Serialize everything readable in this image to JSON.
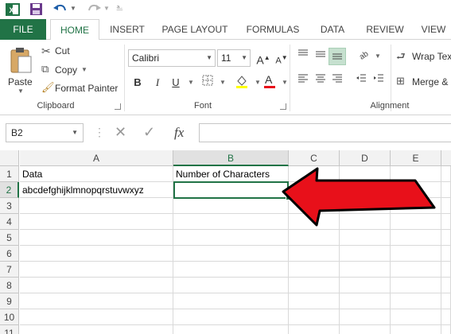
{
  "quick_access": {
    "excel_icon": "excel-icon",
    "save_icon": "save-icon",
    "undo_icon": "undo-icon",
    "redo_icon": "redo-icon",
    "customize_icon": "customize-icon"
  },
  "tabs": [
    "FILE",
    "HOME",
    "INSERT",
    "PAGE LAYOUT",
    "FORMULAS",
    "DATA",
    "REVIEW",
    "VIEW"
  ],
  "clipboard": {
    "paste": "Paste",
    "cut": "Cut",
    "copy": "Copy",
    "format_painter": "Format Painter",
    "group_label": "Clipboard"
  },
  "font": {
    "name": "Calibri",
    "size": "11",
    "bold": "B",
    "italic": "I",
    "underline": "U",
    "group_label": "Font"
  },
  "alignment": {
    "wrap_text": "Wrap Tex",
    "merge": "Merge &",
    "group_label": "Alignment"
  },
  "formula_bar": {
    "name_box": "B2",
    "fx": "fx",
    "value": ""
  },
  "columns": [
    "A",
    "B",
    "C",
    "D",
    "E"
  ],
  "rows": [
    "1",
    "2",
    "3",
    "4",
    "5",
    "6",
    "7",
    "8",
    "9",
    "10",
    "11"
  ],
  "cells": {
    "A1": "Data",
    "B1": "Number of Characters",
    "A2": "abcdefghijklmnopqrstuvwxyz"
  },
  "colors": {
    "accent": "#217346",
    "arrow_fill": "#e8101a"
  }
}
